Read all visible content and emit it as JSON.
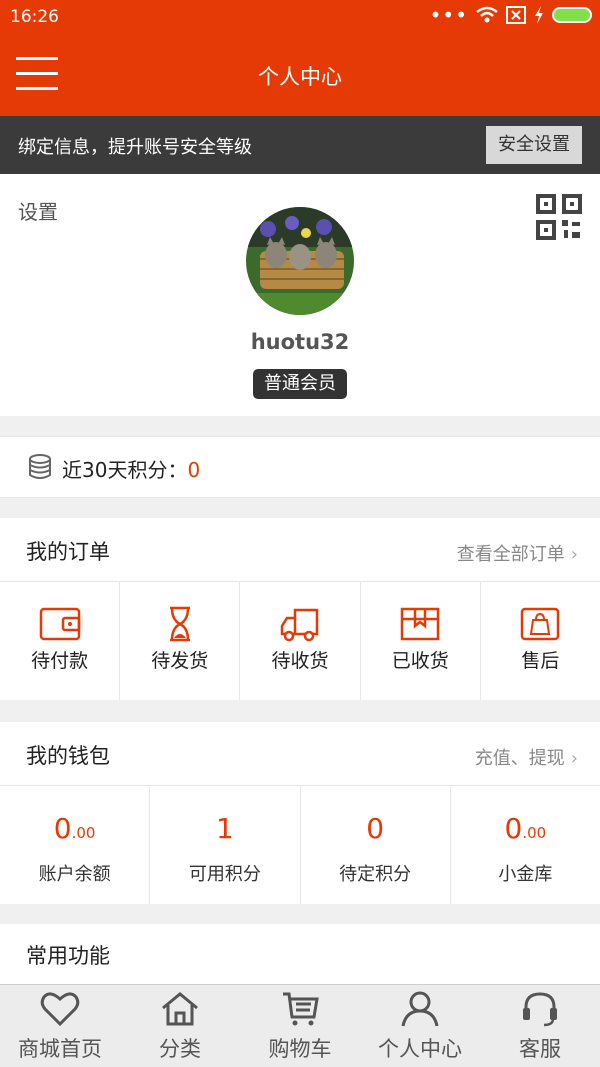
{
  "status_bar": {
    "time": "16:26"
  },
  "header": {
    "title": "个人中心"
  },
  "notice": {
    "text": "绑定信息，提升账号安全等级",
    "button": "安全设置"
  },
  "profile": {
    "settings_label": "设置",
    "username": "huotu32",
    "member_level": "普通会员"
  },
  "points": {
    "label": "近30天积分：",
    "value": "0"
  },
  "orders": {
    "title": "我的订单",
    "more": "查看全部订单",
    "items": [
      {
        "label": "待付款",
        "icon": "wallet-icon"
      },
      {
        "label": "待发货",
        "icon": "hourglass-icon"
      },
      {
        "label": "待收货",
        "icon": "truck-icon"
      },
      {
        "label": "已收货",
        "icon": "box-icon"
      },
      {
        "label": "售后",
        "icon": "bag-icon"
      }
    ]
  },
  "wallet": {
    "title": "我的钱包",
    "more": "充值、提现",
    "items": [
      {
        "int": "0",
        "dec": ".00",
        "label": "账户余额"
      },
      {
        "int": "1",
        "dec": "",
        "label": "可用积分"
      },
      {
        "int": "0",
        "dec": "",
        "label": "待定积分"
      },
      {
        "int": "0",
        "dec": ".00",
        "label": "小金库"
      }
    ]
  },
  "common": {
    "title": "常用功能"
  },
  "tabbar": {
    "items": [
      {
        "label": "商城首页",
        "icon": "heart-icon"
      },
      {
        "label": "分类",
        "icon": "home-icon"
      },
      {
        "label": "购物车",
        "icon": "cart-icon"
      },
      {
        "label": "个人中心",
        "icon": "user-icon"
      },
      {
        "label": "客服",
        "icon": "headset-icon"
      }
    ]
  },
  "colors": {
    "brand": "#e63a06",
    "notice_bg": "#3b3b3b",
    "page_bg": "#f0f0f0"
  }
}
